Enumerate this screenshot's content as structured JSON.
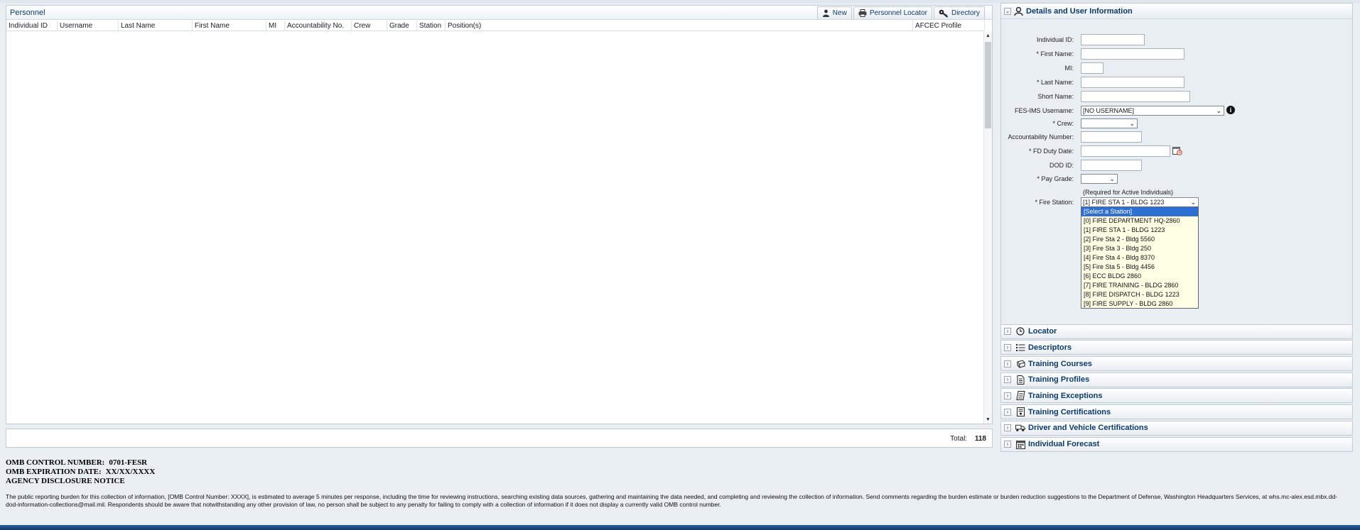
{
  "personnel": {
    "title": "Personnel",
    "toolbar": {
      "new_label": "New",
      "locator_label": "Personnel Locator",
      "directory_label": "Directory"
    },
    "columns": [
      "Individual ID",
      "Username",
      "Last Name",
      "First Name",
      "MI",
      "Accountability No.",
      "Crew",
      "Grade",
      "Station",
      "Position(s)",
      "AFCEC Profile"
    ],
    "total_label": "Total:",
    "total_value": "118"
  },
  "details": {
    "title": "Details and User Information",
    "labels": {
      "individual_id": "Individual ID:",
      "first_name": "* First Name:",
      "mi": "MI:",
      "last_name": "* Last Name:",
      "short_name": "Short Name:",
      "username": "FES-IMS Username:",
      "crew": "* Crew:",
      "accountability": "Accountability Number:",
      "duty_date": "* FD Duty Date:",
      "dod_id": "DOD ID:",
      "pay_grade": "* Pay Grade:",
      "fire_station": "* Fire Station:"
    },
    "username_value": "[NO USERNAME]",
    "station_hint": "(Required for Active Individuals)",
    "fire_station_value": "[1] FIRE STA 1 - BLDG 1223",
    "station_options": [
      "[Select a Station]",
      "[0] FIRE DEPARTMENT HQ-2860",
      "[1] FIRE STA 1 - BLDG 1223",
      "[2] Fire Sta 2 - Bldg 5560",
      "[3] Fire Sta 3 - Bldg 250",
      "[4] Fire Sta 4 - Bldg 8370",
      "[5] Fire Sta 5 - Bldg 4456",
      "[6] ECC BLDG 2860",
      "[7] FIRE TRAINING - BLDG 2860",
      "[8] FIRE DISPATCH - BLDG 1223",
      "[9] FIRE SUPPLY - BLDG 2860"
    ]
  },
  "accordion": [
    {
      "label": "Locator",
      "icon": "clock-icon"
    },
    {
      "label": "Descriptors",
      "icon": "list-icon"
    },
    {
      "label": "Training Courses",
      "icon": "book-icon"
    },
    {
      "label": "Training Profiles",
      "icon": "document-icon"
    },
    {
      "label": "Training Exceptions",
      "icon": "note-icon"
    },
    {
      "label": "Training Certifications",
      "icon": "certificate-icon"
    },
    {
      "label": "Driver and Vehicle Certifications",
      "icon": "vehicle-icon"
    },
    {
      "label": "Individual Forecast",
      "icon": "calendar-icon"
    }
  ],
  "notice": {
    "control_label": "OMB CONTROL NUMBER:",
    "control_value": "0701-FESR",
    "expiration_label": "OMB EXPIRATION DATE:",
    "expiration_value": "XX/XX/XXXX",
    "agency": "AGENCY DISCLOSURE NOTICE",
    "text": "The public reporting burden for this collection of information, [OMB Control Number: XXXX], is estimated to average 5 minutes per response, including the time for reviewing instructions, searching existing data sources, gathering and maintaining the data needed, and completing and reviewing the collection of information. Send comments regarding the burden estimate or burden reduction suggestions to the Department of Defense, Washington Headquarters Services, at whs.mc-alex.esd.mbx.dd-dod-information-collections@mail.mil. Respondents should be aware that notwithstanding any other provision of law, no person shall be subject to any penalty for failing to comply with a collection of information if it does not display a currently valid OMB control number."
  }
}
